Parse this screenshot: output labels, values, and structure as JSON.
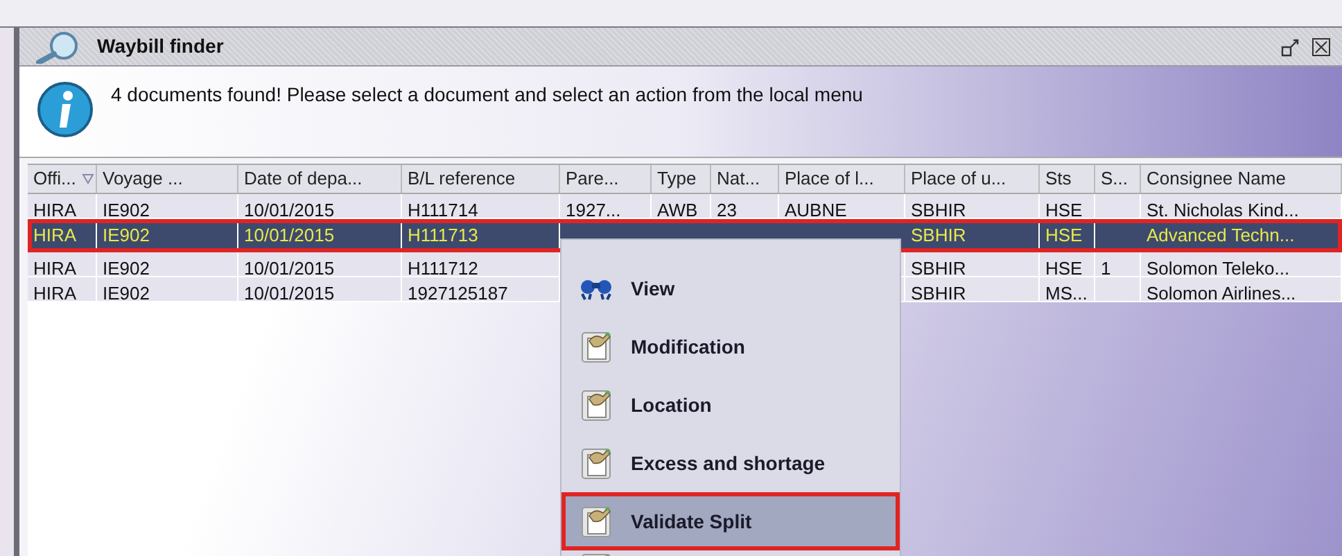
{
  "window": {
    "title": "Waybill finder"
  },
  "info": {
    "message": "4 documents found! Please select a document and select an action from the local menu"
  },
  "table": {
    "columns": [
      {
        "label": "Offi...",
        "sorted": true
      },
      {
        "label": "Voyage ...",
        "sorted": false
      },
      {
        "label": "Date of depa...",
        "sorted": false
      },
      {
        "label": "B/L reference",
        "sorted": false
      },
      {
        "label": "Pare...",
        "sorted": false
      },
      {
        "label": "Type",
        "sorted": false
      },
      {
        "label": "Nat...",
        "sorted": false
      },
      {
        "label": "Place of l...",
        "sorted": false
      },
      {
        "label": "Place of u...",
        "sorted": false
      },
      {
        "label": "Sts",
        "sorted": false
      },
      {
        "label": "S...",
        "sorted": false
      },
      {
        "label": "Consignee Name",
        "sorted": false
      }
    ],
    "rows": [
      {
        "selected": false,
        "highlighted": false,
        "cells": [
          "HIRA",
          "IE902",
          "10/01/2015",
          "H111714",
          "1927...",
          "AWB",
          "23",
          "AUBNE",
          "SBHIR",
          "HSE",
          null,
          "St. Nicholas Kind..."
        ]
      },
      {
        "selected": true,
        "highlighted": true,
        "cells": [
          "HIRA",
          "IE902",
          "10/01/2015",
          "H111713",
          null,
          null,
          null,
          null,
          "SBHIR",
          "HSE",
          null,
          "Advanced Techn..."
        ]
      },
      {
        "selected": false,
        "highlighted": false,
        "cells": [
          "HIRA",
          "IE902",
          "10/01/2015",
          "H111712",
          null,
          null,
          null,
          null,
          "SBHIR",
          "HSE",
          "1",
          "Solomon Teleko..."
        ]
      },
      {
        "selected": false,
        "highlighted": false,
        "cells": [
          "HIRA",
          "IE902",
          "10/01/2015",
          "1927125187",
          null,
          null,
          null,
          null,
          "SBHIR",
          "MS...",
          null,
          "Solomon Airlines..."
        ]
      }
    ]
  },
  "context_menu": {
    "items": [
      {
        "label": "View",
        "kind": "view",
        "highlighted": false
      },
      {
        "label": "Modification",
        "kind": "edit",
        "highlighted": false
      },
      {
        "label": "Location",
        "kind": "edit",
        "highlighted": false
      },
      {
        "label": "Excess and shortage",
        "kind": "edit",
        "highlighted": false
      },
      {
        "label": "Validate Split",
        "kind": "edit",
        "highlighted": true
      }
    ]
  }
}
